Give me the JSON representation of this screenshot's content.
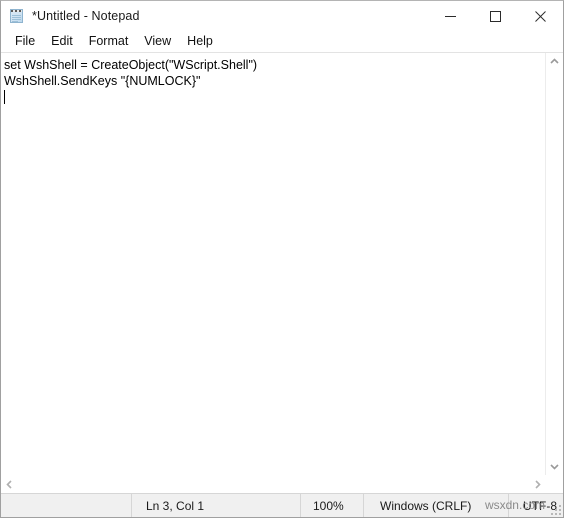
{
  "window": {
    "title": "*Untitled - Notepad",
    "app_icon": "notepad-icon",
    "controls": {
      "minimize": "minimize-icon",
      "maximize": "maximize-icon",
      "close": "close-icon"
    }
  },
  "menubar": {
    "items": [
      {
        "label": "File"
      },
      {
        "label": "Edit"
      },
      {
        "label": "Format"
      },
      {
        "label": "View"
      },
      {
        "label": "Help"
      }
    ]
  },
  "editor": {
    "lines": [
      "set WshShell = CreateObject(\"WScript.Shell\")",
      "WshShell.SendKeys \"{NUMLOCK}\"",
      ""
    ],
    "caret_line": 3,
    "caret_col": 1
  },
  "scrollbars": {
    "vertical": {
      "up_arrow": "chevron-up-icon",
      "down_arrow": "chevron-down-icon"
    },
    "horizontal": {
      "left_arrow": "chevron-left-icon",
      "right_arrow": "chevron-right-icon"
    }
  },
  "statusbar": {
    "position": "Ln 3, Col 1",
    "zoom": "100%",
    "line_ending": "Windows (CRLF)",
    "encoding": "UTF-8",
    "watermark": "wsxdn.com"
  },
  "colors": {
    "window_bg": "#ffffff",
    "statusbar_bg": "#f0f0f0",
    "border": "#d6d6d6",
    "text": "#000000",
    "watermark": "#8a8a8a"
  }
}
